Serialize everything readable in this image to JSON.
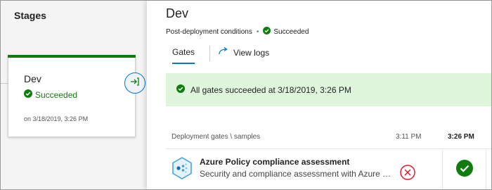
{
  "stages_pane": {
    "title": "Stages",
    "stage": {
      "name": "Dev",
      "status": "Succeeded",
      "date": "on 3/18/2019, 3:26 PM"
    }
  },
  "detail": {
    "title": "Dev",
    "subtitle": "Post-deployment conditions",
    "status": "Succeeded",
    "tabs": {
      "gates": "Gates",
      "view_logs": "View logs"
    },
    "banner": "All gates succeeded at 3/18/2019, 3:26 PM",
    "gates_table": {
      "header": "Deployment gates \\ samples",
      "columns": [
        "3:11 PM",
        "3:26 PM"
      ],
      "row": {
        "name": "Azure Policy compliance assessment",
        "description": "Security and compliance assessment with Azure Policy"
      }
    }
  },
  "colors": {
    "success": "#107c10",
    "accent": "#0078d4",
    "error": "#e81123",
    "banner_bg": "#dff6dd"
  },
  "icons": {
    "stage_status": "check-circle-icon",
    "gate_connector": "arrow-into-bracket-icon",
    "view_logs": "redo-arrow-icon",
    "gate_row": "azure-policy-icon",
    "result_311": "error-circle-icon",
    "result_326": "success-circle-icon"
  }
}
